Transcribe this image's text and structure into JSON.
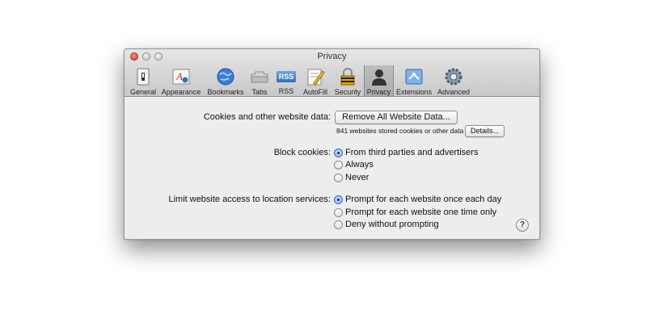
{
  "window": {
    "title": "Privacy"
  },
  "toolbar": {
    "tabs": [
      {
        "label": "General",
        "icon": "switch-icon"
      },
      {
        "label": "Appearance",
        "icon": "font-icon"
      },
      {
        "label": "Bookmarks",
        "icon": "globe-icon"
      },
      {
        "label": "Tabs",
        "icon": "tabs-icon"
      },
      {
        "label": "RSS",
        "icon": "rss-icon",
        "badge": "RSS"
      },
      {
        "label": "AutoFill",
        "icon": "pencil-icon"
      },
      {
        "label": "Security",
        "icon": "lock-icon"
      },
      {
        "label": "Privacy",
        "icon": "person-silhouette-icon",
        "selected": true
      },
      {
        "label": "Extensions",
        "icon": "puzzle-icon"
      },
      {
        "label": "Advanced",
        "icon": "gear-icon"
      }
    ]
  },
  "cookies": {
    "label": "Cookies and other website data:",
    "remove_button": "Remove All Website Data...",
    "stored_text": "841 websites stored cookies or other data",
    "details_button": "Details..."
  },
  "block_cookies": {
    "label": "Block cookies:",
    "options": [
      {
        "label": "From third parties and advertisers",
        "selected": true
      },
      {
        "label": "Always",
        "selected": false
      },
      {
        "label": "Never",
        "selected": false
      }
    ]
  },
  "location": {
    "label": "Limit website access to location services:",
    "options": [
      {
        "label": "Prompt for each website once each day",
        "selected": true
      },
      {
        "label": "Prompt for each website one time only",
        "selected": false
      },
      {
        "label": "Deny without prompting",
        "selected": false
      }
    ]
  },
  "help": {
    "symbol": "?"
  },
  "colors": {
    "accent": "#3c6fb6",
    "close": "#d03a30"
  }
}
